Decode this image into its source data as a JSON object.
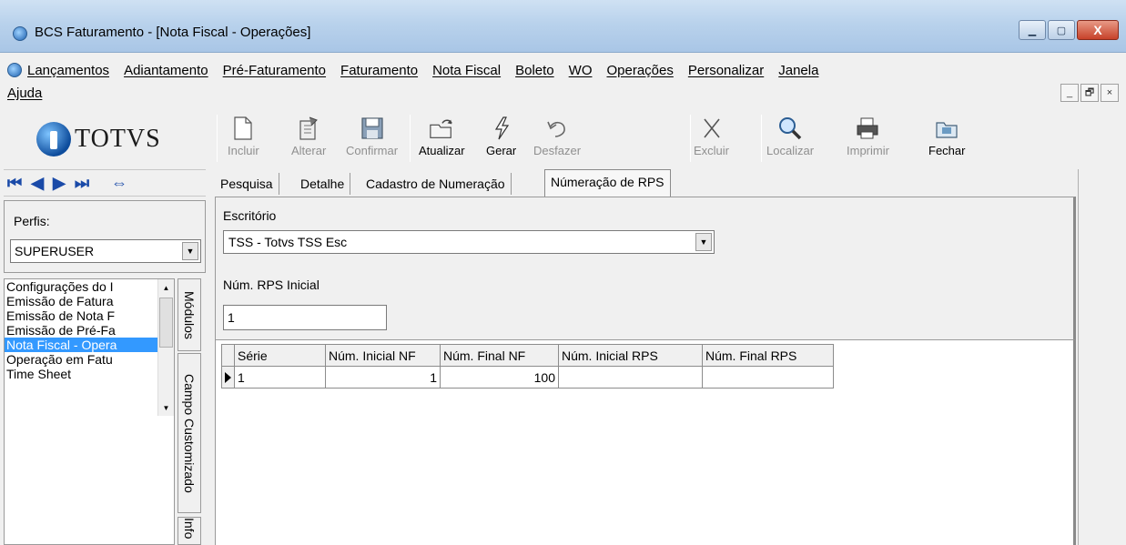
{
  "window": {
    "title": "BCS Faturamento - [Nota Fiscal - Operações]",
    "minimize_label": "▁",
    "restore_label": "▢",
    "close_label": "X"
  },
  "menu": {
    "items": [
      "Lançamentos",
      "Adiantamento",
      "Pré-Faturamento",
      "Faturamento",
      "Nota Fiscal",
      "Boleto",
      "WO",
      "Operações",
      "Personalizar",
      "Janela",
      "Ajuda"
    ],
    "mdi_buttons": [
      "_",
      "🗗",
      "×"
    ]
  },
  "logo": {
    "text": "TOTVS"
  },
  "navigation": {
    "first": "⏮",
    "prev": "◀",
    "next": "▶",
    "last": "⏭",
    "sync": "⇔"
  },
  "perfis": {
    "label": "Perfis:",
    "selected": "SUPERUSER"
  },
  "modules": {
    "items": [
      "Configurações do I",
      "Emissão de Fatura",
      "Emissão de Nota F",
      "Emissão de Pré-Fa",
      "Nota Fiscal - Opera",
      "Operação em Fatu",
      "Time Sheet"
    ],
    "selected_index": 4
  },
  "vertical_tabs": [
    "Módulos",
    "Campo Customizado",
    "Info"
  ],
  "toolbar": {
    "buttons": [
      {
        "label": "Incluir",
        "icon": "new-document-icon",
        "enabled": false
      },
      {
        "label": "Alterar",
        "icon": "edit-document-icon",
        "enabled": false
      },
      {
        "label": "Confirmar",
        "icon": "save-disk-icon",
        "enabled": false
      },
      {
        "label": "Atualizar",
        "icon": "refresh-folder-icon",
        "enabled": true
      },
      {
        "label": "Gerar",
        "icon": "lightning-icon",
        "enabled": true
      },
      {
        "label": "Desfazer",
        "icon": "undo-icon",
        "enabled": false
      },
      {
        "label": "Excluir",
        "icon": "delete-x-icon",
        "enabled": false
      },
      {
        "label": "Localizar",
        "icon": "magnifier-icon",
        "enabled": false
      },
      {
        "label": "Imprimir",
        "icon": "printer-icon",
        "enabled": false
      },
      {
        "label": "Fechar",
        "icon": "close-folder-icon",
        "enabled": true
      }
    ]
  },
  "tabs": [
    {
      "label": "Pesquisa",
      "active": false
    },
    {
      "label": "Detalhe",
      "active": false
    },
    {
      "label": "Cadastro de Numeração",
      "active": false
    },
    {
      "label": "Númeração de RPS",
      "active": true
    }
  ],
  "form": {
    "escritorio_label": "Escritório",
    "escritorio_value": "TSS - Totvs TSS Esc",
    "rps_label": "Núm. RPS Inicial",
    "rps_value": "1"
  },
  "grid": {
    "columns": [
      "Série",
      "Núm. Inicial NF",
      "Núm. Final NF",
      "Núm. Inicial RPS",
      "Núm. Final RPS"
    ],
    "rows": [
      [
        "1",
        "1",
        "100",
        "",
        ""
      ]
    ]
  },
  "colors": {
    "selection": "#3399ff",
    "logo_blue": "#0d4c9c",
    "disabled_text": "#8f8f8f"
  }
}
